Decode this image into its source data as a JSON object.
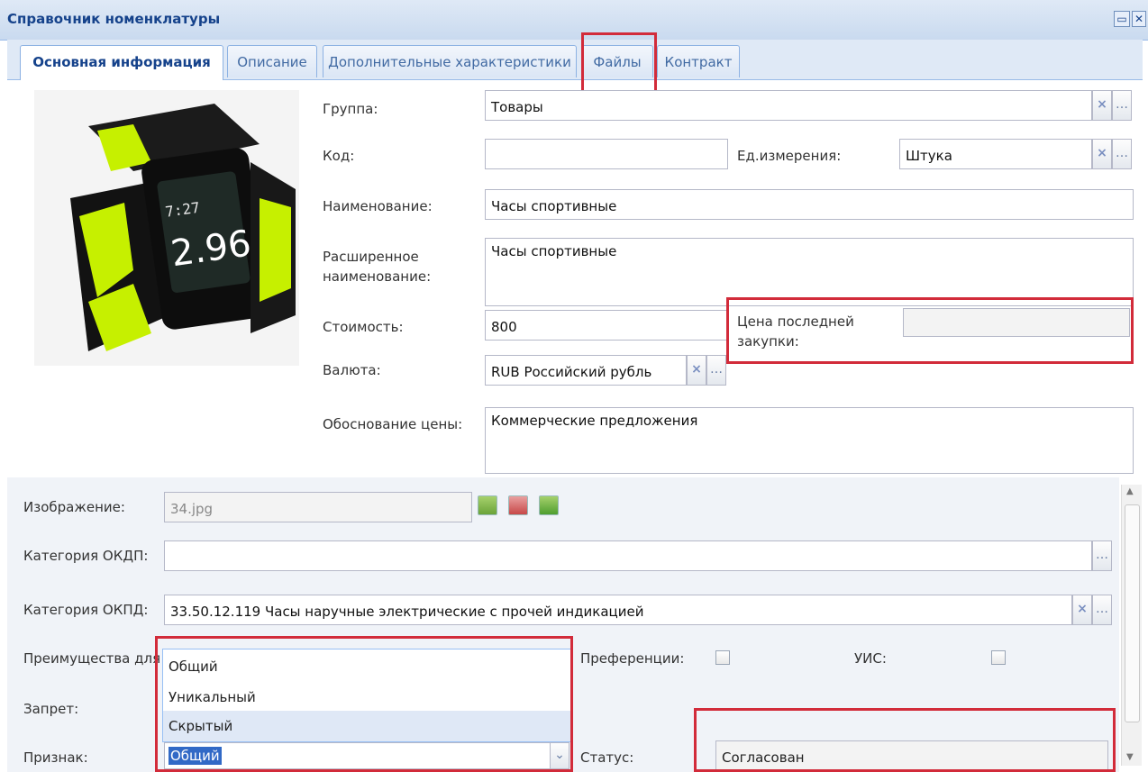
{
  "window": {
    "title": "Справочник номенклатуры",
    "restore_icon": "restore-icon",
    "close_icon": "close-icon"
  },
  "tabs": [
    {
      "label": "Основная информация",
      "active": true
    },
    {
      "label": "Описание",
      "active": false
    },
    {
      "label": "Дополнительные характеристики",
      "active": false
    },
    {
      "label": "Файлы",
      "active": false
    },
    {
      "label": "Контракт",
      "active": false
    }
  ],
  "product_image": {
    "watch_text_top": "7:27",
    "watch_text_main": "2.96"
  },
  "form": {
    "group_label": "Группа:",
    "group_value": "Товары",
    "code_label": "Код:",
    "code_value": "",
    "unit_label": "Ед.измерения:",
    "unit_value": "Штука",
    "name_label": "Наименование:",
    "name_value": "Часы спортивные",
    "ext_name_label": "Расширенное наименование:",
    "ext_name_value": "Часы спортивные",
    "cost_label": "Стоимость:",
    "cost_value": "800",
    "last_price_label": "Цена последней закупки:",
    "last_price_value": "",
    "currency_label": "Валюта:",
    "currency_value": "RUB Российский рубль",
    "price_reason_label": "Обоснование цены:",
    "price_reason_value": "Коммерческие предложения",
    "image_label": "Изображение:",
    "image_value": "34.jpg",
    "okdp_label": "Категория ОКДП:",
    "okdp_value": "",
    "okpd_label": "Категория ОКПД:",
    "okpd_value": "33.50.12.119 Часы наручные электрические с прочей индикацией",
    "advantages_label": "Преимущества для",
    "preferences_label": "Преференции:",
    "uis_label": "УИС:",
    "ban_label": "Запрет:",
    "sign_label": "Признак:",
    "sign_value": "Общий",
    "status_label": "Статус:",
    "status_value": "Согласован"
  },
  "dropdown": {
    "options": [
      "Общий",
      "Уникальный",
      "Скрытый"
    ]
  },
  "colors": {
    "accent": "#15428b",
    "highlight": "#d22b3a",
    "selection": "#3169c6"
  }
}
